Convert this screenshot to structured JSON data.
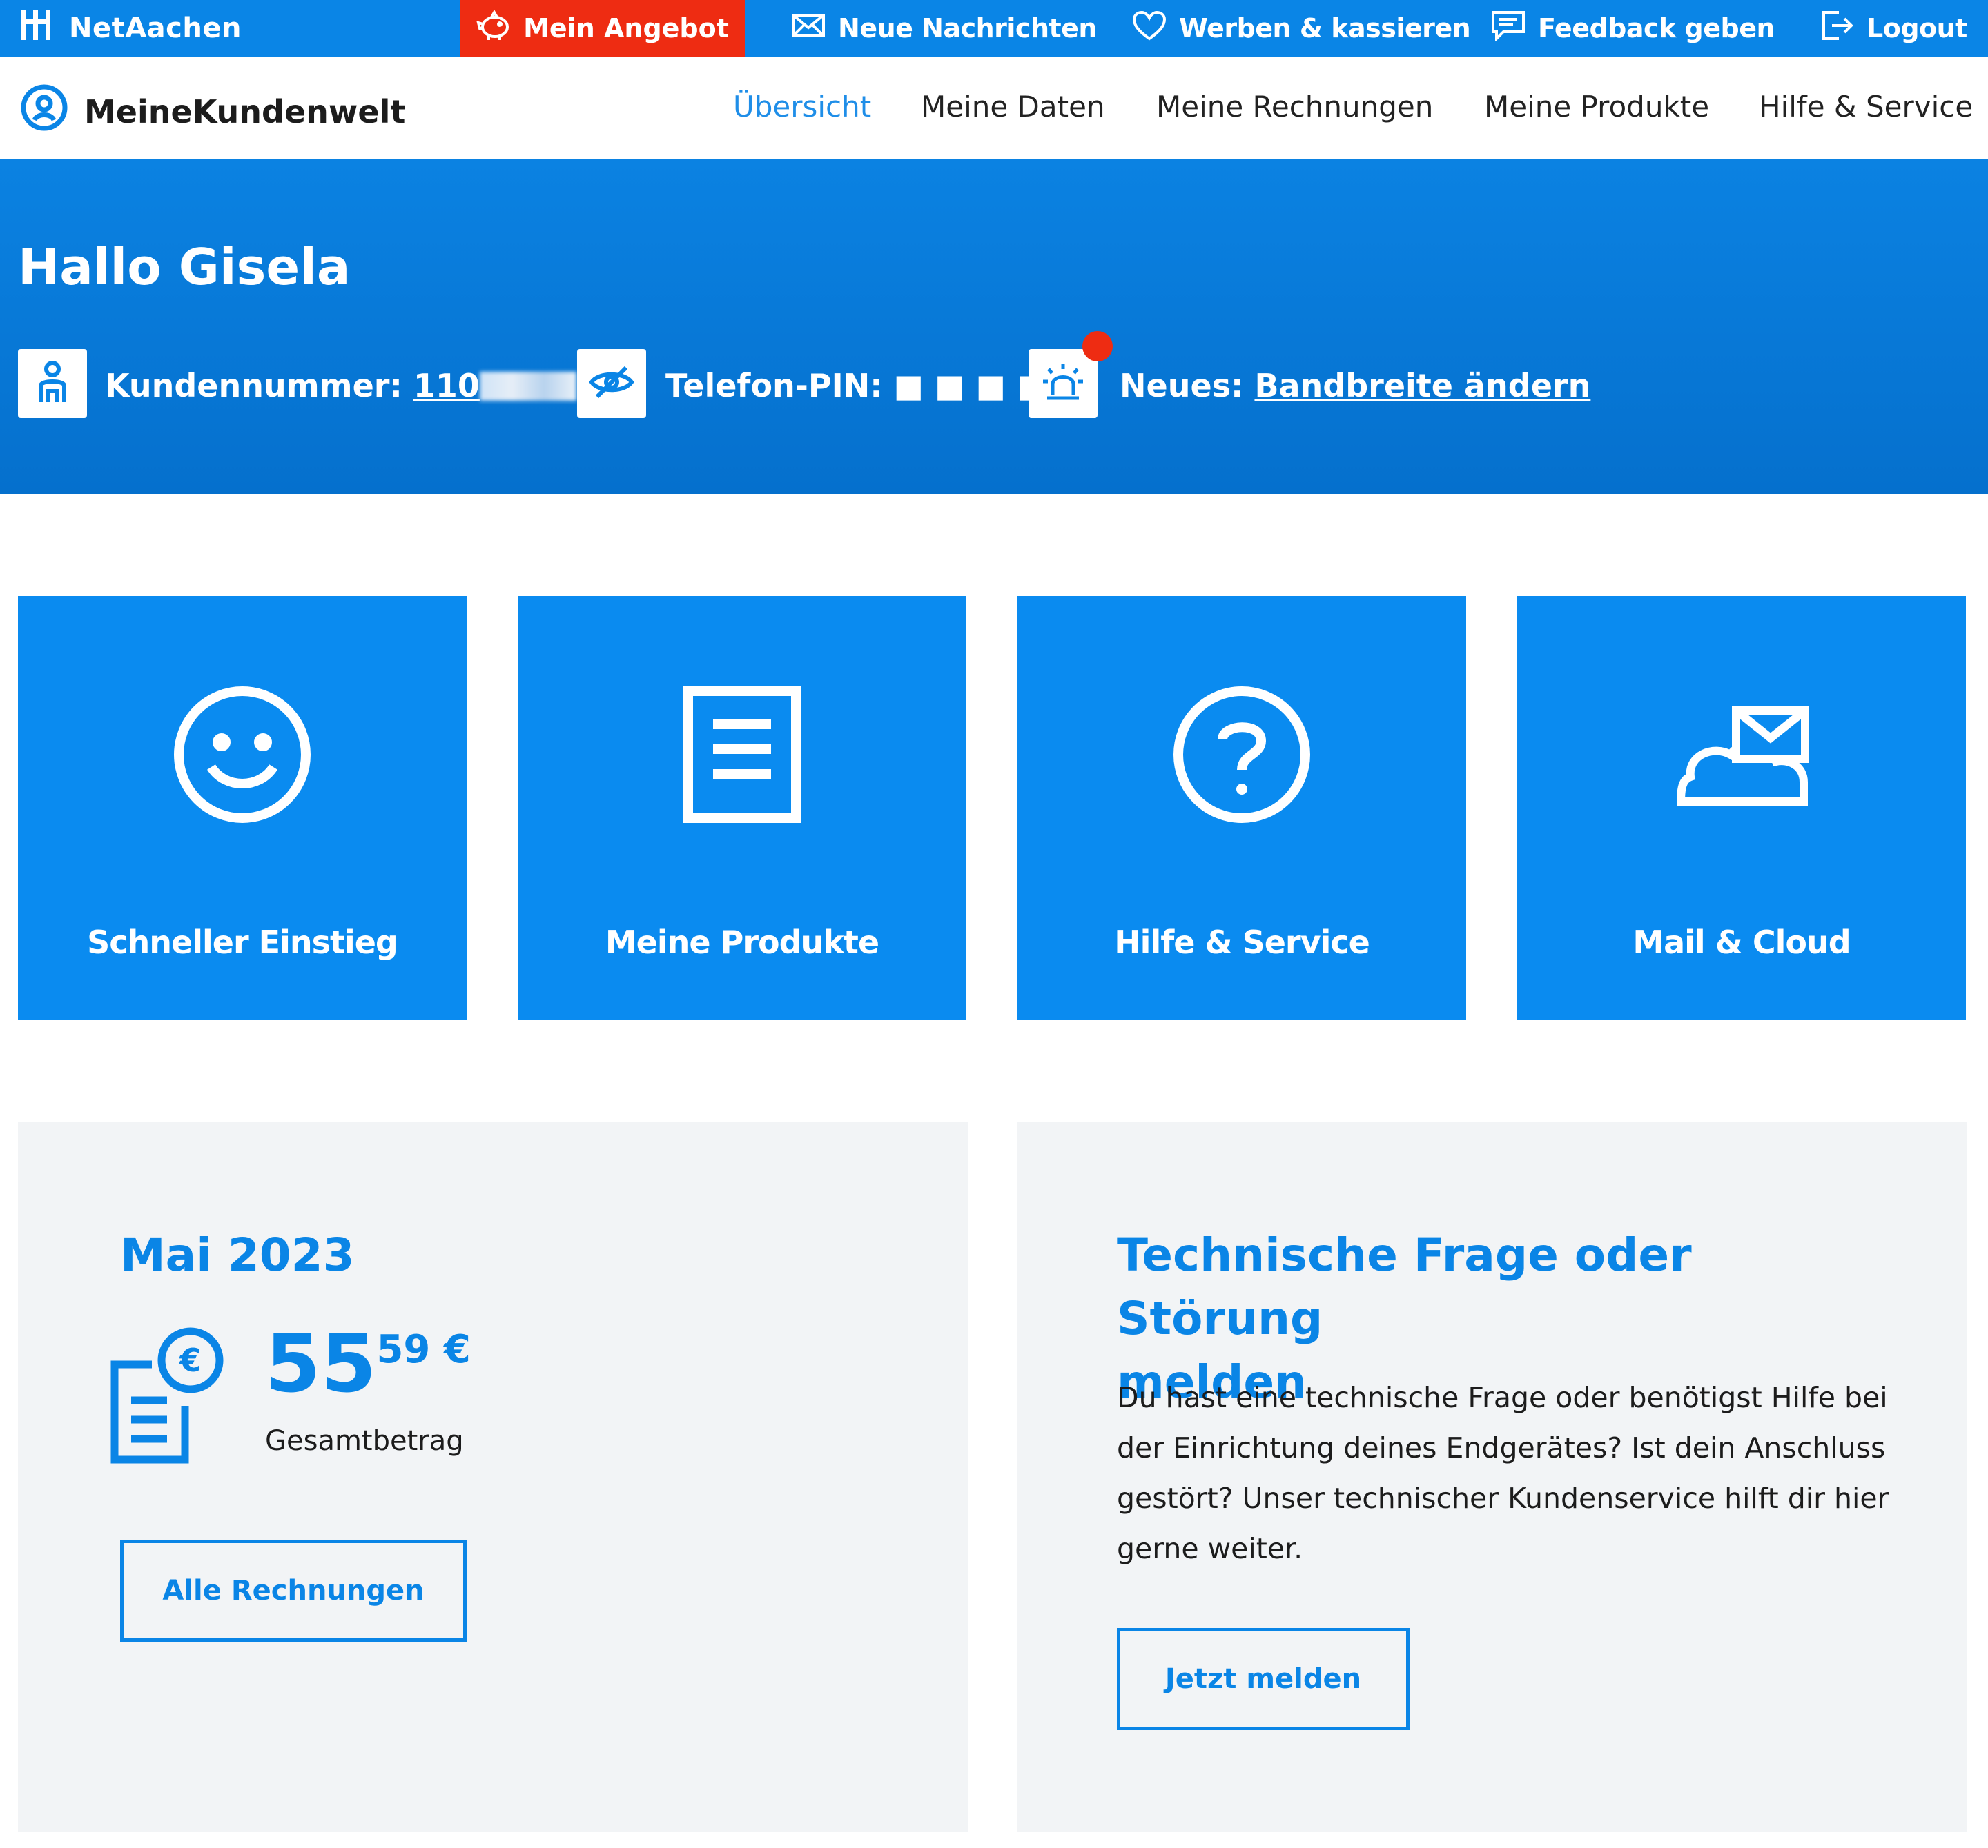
{
  "topbar": {
    "brand": "NetAachen",
    "offer_label": "Mein Angebot",
    "links": {
      "messages": "Neue Nachrichten",
      "refer": "Werben & kassieren",
      "feedback": "Feedback geben",
      "logout": "Logout"
    }
  },
  "nav": {
    "logo_text": "MeineKundenwelt",
    "items": [
      "Übersicht",
      "Meine Daten",
      "Meine Rechnungen",
      "Meine Produkte",
      "Hilfe & Service"
    ],
    "active": "Übersicht"
  },
  "hero": {
    "greeting": "Hallo Gisela",
    "customer_label": "Kundennummer:",
    "customer_value": "110",
    "pin_label": "Telefon-PIN:",
    "pin_value": "■ ■ ■ ■",
    "news_label": "Neues:",
    "news_link": "Bandbreite ändern"
  },
  "tiles": [
    {
      "label": "Schneller Einstieg",
      "icon": "smiley-icon"
    },
    {
      "label": "Meine Produkte",
      "icon": "document-icon"
    },
    {
      "label": "Hilfe & Service",
      "icon": "question-icon"
    },
    {
      "label": "Mail & Cloud",
      "icon": "cloud-mail-icon"
    }
  ],
  "bill": {
    "title": "Mai 2023",
    "amount_whole": "55",
    "amount_cents": "59",
    "currency": "€",
    "amount_label": "Gesamtbetrag",
    "button": "Alle Rechnungen"
  },
  "support": {
    "title_line1": "Technische Frage oder Störung",
    "title_line2": "melden",
    "text": "Du hast eine technische Frage oder benötigst Hilfe bei der Einrichtung deines Endgerätes? Ist dein Anschluss gestört? Unser technischer Kundenservice hilft dir hier gerne weiter.",
    "button": "Jetzt melden"
  },
  "colors": {
    "brand_blue": "#0a85e6",
    "tile_blue": "#0a8bf0",
    "offer_red": "#ee2c12",
    "card_bg": "#f2f4f6"
  }
}
